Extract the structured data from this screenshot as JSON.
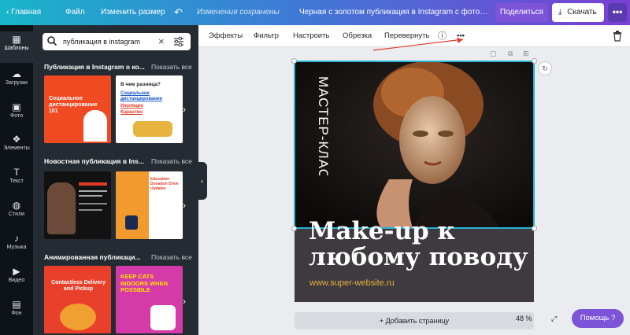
{
  "topbar": {
    "home": "Главная",
    "file": "Файл",
    "resize": "Изменить размер",
    "saved": "Изменения сохранены",
    "title": "Черная с золотом публикация в Instagram с фотограф...",
    "share": "Поделиться",
    "download": "Скачать",
    "more": "•••"
  },
  "rail": [
    {
      "label": "Шаблоны",
      "icon": "templates-icon",
      "glyph": "▦"
    },
    {
      "label": "Загрузки",
      "icon": "upload-icon",
      "glyph": "☁"
    },
    {
      "label": "Фото",
      "icon": "photo-icon",
      "glyph": "▣"
    },
    {
      "label": "Элементы",
      "icon": "elements-icon",
      "glyph": "❖"
    },
    {
      "label": "Текст",
      "icon": "text-icon",
      "glyph": "T"
    },
    {
      "label": "Стили",
      "icon": "styles-icon",
      "glyph": "◍"
    },
    {
      "label": "Музыка",
      "icon": "music-icon",
      "glyph": "♪"
    },
    {
      "label": "Видео",
      "icon": "video-icon",
      "glyph": "▶"
    },
    {
      "label": "Фон",
      "icon": "background-icon",
      "glyph": "▤"
    }
  ],
  "search": {
    "value": "публикация в instagram"
  },
  "sections": [
    {
      "title": "Публикация в Instagram о ко...",
      "all": "Показать все"
    },
    {
      "title": "Новостная публикация в Ins...",
      "all": "Показать все"
    },
    {
      "title": "Анимированная публикаци...",
      "all": "Показать все"
    }
  ],
  "thumbs": {
    "t1": "Социальное дистанцирование 101",
    "t2a": "В чем разница?",
    "t2b": "Социальное дистанцирование",
    "t2c": "Изоляция",
    "t2d": "Карантин",
    "t4": "Education Donation Drive Updates",
    "t5": "Contactless Delivery and Pickup",
    "t6": "KEEP CATS INDOORS WHEN POSSIBLE"
  },
  "toolbar": {
    "effects": "Эффекты",
    "filter": "Фильтр",
    "adjust": "Настроить",
    "crop": "Обрезка",
    "flip": "Перевернуть",
    "more": "•••"
  },
  "design": {
    "vertical": "МАСТЕР-КЛАСС",
    "headline1": "Make-up к",
    "headline2": "любому поводу",
    "url": "www.super-website.ru"
  },
  "addpage": "+ Добавить страницу",
  "zoom": "48 %",
  "help": "Помощь ?"
}
